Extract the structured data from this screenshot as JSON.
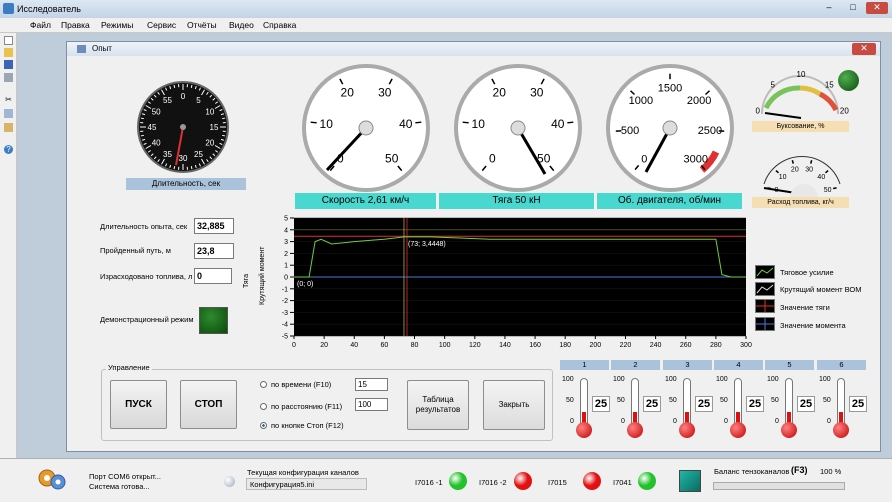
{
  "window": {
    "title": "Исследователь",
    "min": "–",
    "max": "□",
    "close": "✕"
  },
  "menu": [
    "Файл",
    "Правка",
    "Режимы",
    "Сервис",
    "Отчёты",
    "Видео",
    "Справка"
  ],
  "toolbar_icons": [
    "new-icon",
    "open-icon",
    "save-icon",
    "print-icon",
    "cut-icon",
    "copy-icon",
    "paste-icon",
    "help-icon"
  ],
  "child": {
    "title": "Опыт",
    "close": "✕"
  },
  "duration_gauge": {
    "label": "Длительность, сек",
    "ticks": [
      "0",
      "5",
      "10",
      "15",
      "20",
      "25",
      "30",
      "35",
      "40",
      "45",
      "50",
      "55"
    ],
    "value": 33
  },
  "speed_gauge": {
    "ticks": [
      "0",
      "10",
      "20",
      "30",
      "40",
      "50"
    ],
    "label": "Скорость 2,61 км/ч",
    "value": 2.61
  },
  "traction_gauge": {
    "ticks": [
      "0",
      "10",
      "20",
      "30",
      "40",
      "50"
    ],
    "label": "Тяга 50 кН",
    "value": 50
  },
  "rpm_gauge": {
    "ticks": [
      "0",
      "500",
      "1000",
      "1500",
      "2000",
      "2500",
      "3000"
    ],
    "label": "Об. двигателя, об/мин",
    "value": 400
  },
  "slip_gauge": {
    "ticks": [
      "0",
      "5",
      "10",
      "15",
      "20"
    ],
    "label": "Буксование, %",
    "value": 0
  },
  "fuel_gauge": {
    "ticks": [
      "0",
      "10",
      "20",
      "30",
      "40",
      "50"
    ],
    "label": "Расход топлива, кг/ч",
    "value": 0
  },
  "readouts": [
    {
      "label": "Длительность опыта, сек",
      "value": "32,885"
    },
    {
      "label": "Пройденный путь, м",
      "value": "23,8"
    },
    {
      "label": "Израсходовано топлива, л",
      "value": "0"
    }
  ],
  "demo_label": "Демонстрационный режим",
  "chart": {
    "ylabel_left": "Тяга",
    "ylabel_right": "Крутящий момент",
    "yticks": [
      "5",
      "4",
      "3",
      "2",
      "1",
      "0",
      "-1",
      "-2",
      "-3",
      "-4",
      "-5"
    ],
    "xticks": [
      "0",
      "20",
      "40",
      "60",
      "80",
      "100",
      "120",
      "140",
      "160",
      "180",
      "200",
      "220",
      "240",
      "260",
      "280",
      "300"
    ],
    "cursor_label": "(73; 3,4448)",
    "origin_label": "(0; 0)"
  },
  "chart_data": {
    "type": "line",
    "xlim": [
      0,
      300
    ],
    "ylim": [
      -5,
      5
    ],
    "series": [
      {
        "name": "Тяговое усилие",
        "x": [
          0,
          10,
          14,
          18,
          25,
          40,
          60,
          73,
          90,
          110,
          130,
          150,
          170,
          190,
          210,
          230,
          250,
          270,
          280,
          284,
          290,
          300
        ],
        "y": [
          0,
          0,
          3.0,
          3.2,
          2.8,
          3.0,
          3.2,
          3.4,
          3.4,
          3.3,
          3.2,
          3.2,
          3.2,
          3.2,
          3.2,
          3.2,
          3.2,
          3.2,
          3.2,
          0.2,
          0,
          0
        ]
      }
    ]
  },
  "legend": [
    "Тяговое усилие",
    "Крутящий момент ВОМ",
    "Значение тяги",
    "Значение момента"
  ],
  "control": {
    "title": "Управление",
    "start": "ПУСК",
    "stop": "СТОП",
    "radios": [
      "по времени (F10)",
      "по расстоянию (F11)",
      "по кнопке Стоп (F12)"
    ],
    "time_value": "15",
    "dist_value": "100",
    "table_btn": "Таблица результатов",
    "close_btn": "Закрыть"
  },
  "thermometers": [
    {
      "id": "1",
      "value": "25"
    },
    {
      "id": "2",
      "value": "25"
    },
    {
      "id": "3",
      "value": "25"
    },
    {
      "id": "4",
      "value": "25"
    },
    {
      "id": "5",
      "value": "25"
    },
    {
      "id": "6",
      "value": "25"
    }
  ],
  "therm_ticks": [
    "100",
    "50",
    "0"
  ],
  "status": {
    "port": "Порт COM6 открыт...",
    "ready": "Система готова...",
    "config_title": "Текущая конфигурация каналов",
    "config_file": "Конфигурация5.ini",
    "modules": [
      {
        "name": "I7016 -1",
        "color": "#22c22a"
      },
      {
        "name": "I7016 -2",
        "color": "#e21010"
      },
      {
        "name": "I7015",
        "color": "#e21010"
      },
      {
        "name": "I7041",
        "color": "#22c22a"
      }
    ],
    "balance": "Баланс тензоканалов",
    "balance_key": "(F3)",
    "percent": "100 %"
  }
}
